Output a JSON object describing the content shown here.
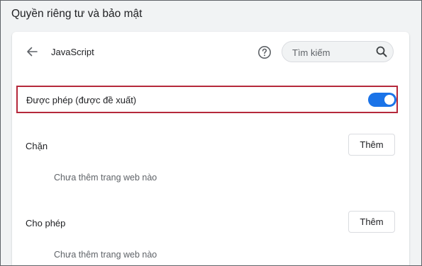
{
  "page": {
    "title": "Quyền riêng tư và bảo mật"
  },
  "subpage": {
    "back_icon": "arrow-back-icon",
    "title": "JavaScript",
    "help_icon": "help-circle-icon"
  },
  "search": {
    "placeholder": "Tìm kiếm",
    "icon": "search-icon"
  },
  "default_setting": {
    "label": "Được phép (được đề xuất)",
    "enabled": true,
    "highlight_color": "#b5283b",
    "toggle_color": "#1a73e8"
  },
  "sections": [
    {
      "label": "Chặn",
      "add_label": "Thêm",
      "empty_text": "Chưa thêm trang web nào"
    },
    {
      "label": "Cho phép",
      "add_label": "Thêm",
      "empty_text": "Chưa thêm trang web nào"
    }
  ]
}
